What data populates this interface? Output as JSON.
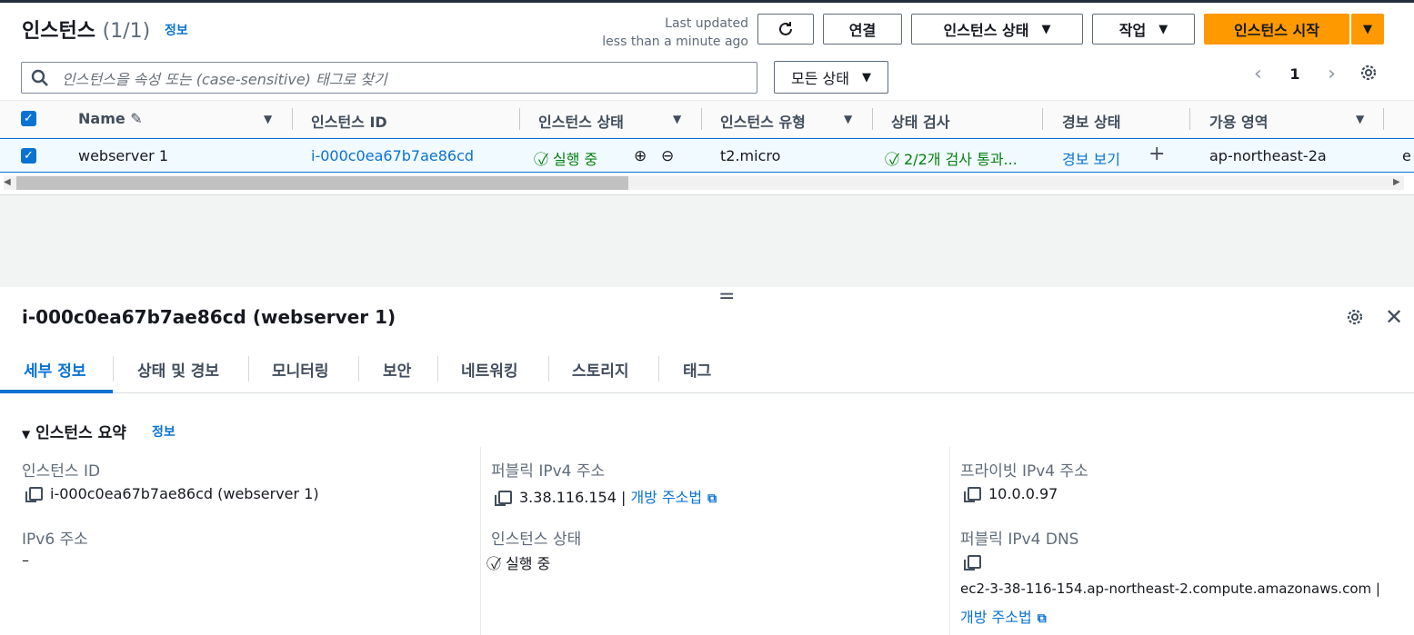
{
  "header": {
    "title": "인스턴스",
    "count": "(1/1)",
    "info": "정보",
    "last_updated_line1": "Last updated",
    "last_updated_line2": "less than a minute ago",
    "buttons": {
      "connect": "연결",
      "instance_state": "인스턴스 상태",
      "actions": "작업",
      "launch": "인스턴스 시작"
    }
  },
  "search": {
    "placeholder": "인스턴스을 속성 또는 (case-sensitive) 태그로 찾기"
  },
  "filter": {
    "selected": "모든 상태"
  },
  "pager": {
    "page": "1"
  },
  "table": {
    "headers": [
      "Name",
      "인스턴스 ID",
      "인스턴스 상태",
      "인스턴스 유형",
      "상태 검사",
      "경보 상태",
      "가용 영역"
    ],
    "rows": [
      {
        "name": "webserver 1",
        "id": "i-000c0ea67b7ae86cd",
        "state": "실행 중",
        "type": "t2.micro",
        "check": "2/2개 검사 통과...",
        "alarm": "경보 보기",
        "az": "ap-northeast-2a",
        "extra": "e"
      }
    ]
  },
  "detail": {
    "title": "i-000c0ea67b7ae86cd (webserver 1)",
    "tabs": [
      "세부 정보",
      "상태 및 경보",
      "모니터링",
      "보안",
      "네트워킹",
      "스토리지",
      "태그"
    ],
    "section_title": "인스턴스 요약",
    "section_info": "정보",
    "fields": {
      "instance_id_label": "인스턴스 ID",
      "instance_id_value": "i-000c0ea67b7ae86cd (webserver 1)",
      "public_ipv4_label": "퍼블릭 IPv4 주소",
      "public_ipv4_value": "3.38.116.154",
      "open_address": "개방 주소법",
      "private_ipv4_label": "프라이빗 IPv4 주소",
      "private_ipv4_value": "10.0.0.97",
      "ipv6_label": "IPv6 주소",
      "ipv6_value": "–",
      "state_label": "인스턴스 상태",
      "state_value": "실행 중",
      "public_dns_label": "퍼블릭 IPv4 DNS",
      "public_dns_value": "ec2-3-38-116-154.ap-northeast-2.compute.amazonaws.com"
    }
  },
  "colors": {
    "accent": "#0972d3",
    "primary": "#ff9900",
    "success": "#037f0c"
  }
}
